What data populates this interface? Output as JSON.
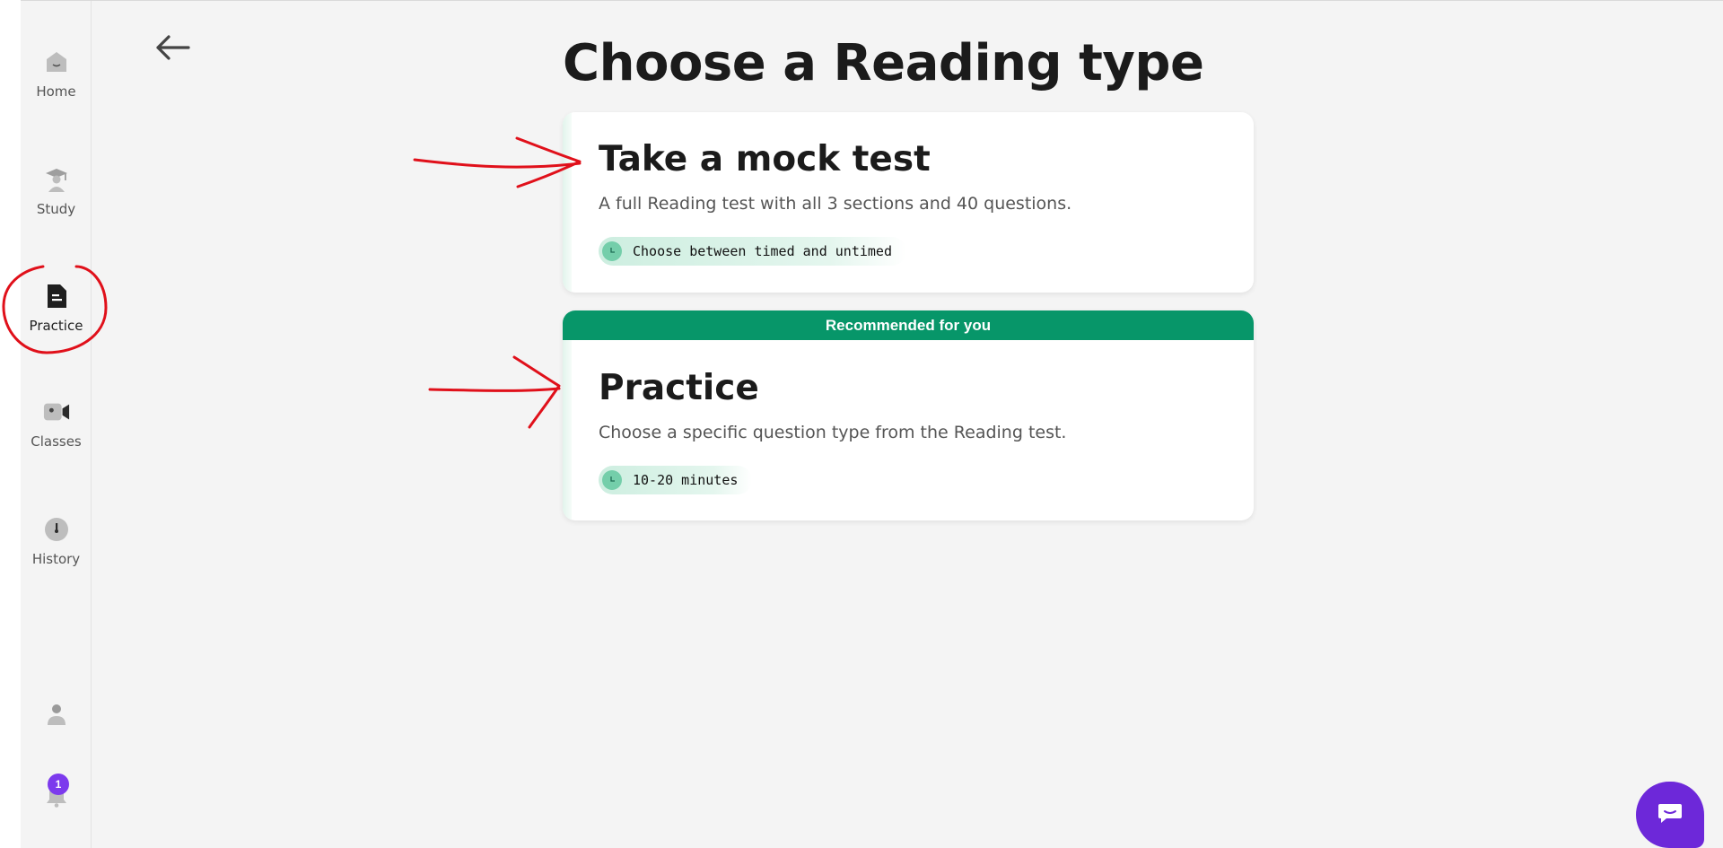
{
  "sidebar": {
    "items": [
      {
        "label": "Home",
        "icon": "home-icon"
      },
      {
        "label": "Study",
        "icon": "graduation-cap-icon"
      },
      {
        "label": "Practice",
        "icon": "document-icon",
        "active": true
      },
      {
        "label": "Classes",
        "icon": "video-camera-icon"
      },
      {
        "label": "History",
        "icon": "clock-icon"
      }
    ],
    "profile_icon": "user-icon",
    "notifications": {
      "icon": "bell-icon",
      "badge": "1"
    }
  },
  "header": {
    "back_icon": "arrow-left-icon",
    "title": "Choose a Reading type"
  },
  "cards": [
    {
      "title": "Take a mock test",
      "description": "A full Reading test with all 3 sections and 40 questions.",
      "tag": "Choose between timed and untimed"
    },
    {
      "banner": "Recommended for you",
      "title": "Practice",
      "description": "Choose a specific question type from the Reading test.",
      "tag": "10-20 minutes"
    }
  ],
  "chat": {
    "icon": "chat-bubble-icon"
  },
  "colors": {
    "accent_green": "#079669",
    "pill_green": "#cdeee0",
    "badge_purple": "#7c3aed",
    "chat_purple": "#6d28d9",
    "annotation_red": "#e0101a"
  }
}
